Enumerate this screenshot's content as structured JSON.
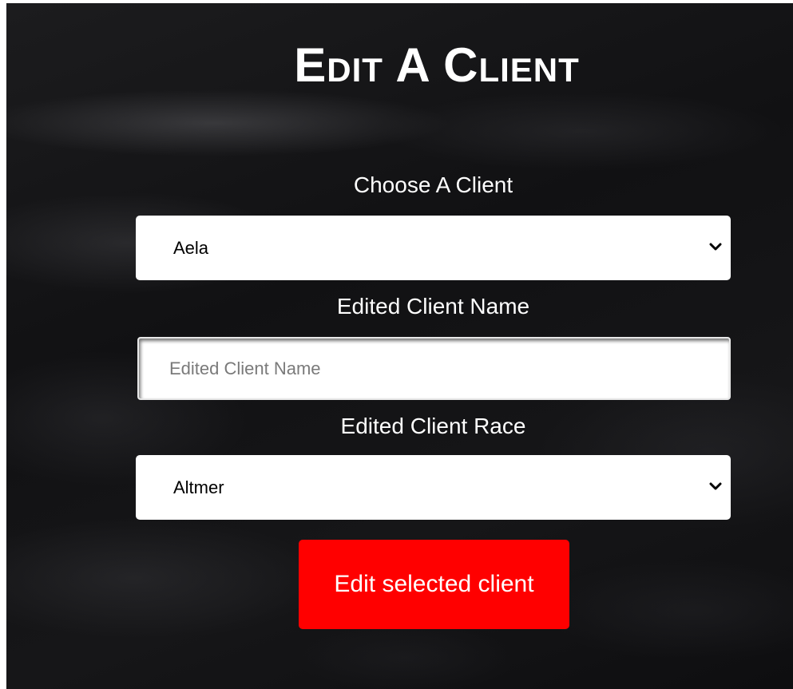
{
  "page": {
    "title": "Edit A Client"
  },
  "client_select": {
    "label": "Choose A Client",
    "selected": "Aela"
  },
  "name_field": {
    "label": "Edited Client Name",
    "value": "",
    "placeholder": "Edited Client Name"
  },
  "race_select": {
    "label": "Edited Client Race",
    "selected": "Altmer"
  },
  "submit_button": {
    "label": "Edit selected client"
  },
  "colors": {
    "button_background": "#ff0000",
    "text": "#ffffff",
    "field_background": "#ffffff"
  },
  "icons": {
    "select_chevron": "chevron-down-icon"
  }
}
